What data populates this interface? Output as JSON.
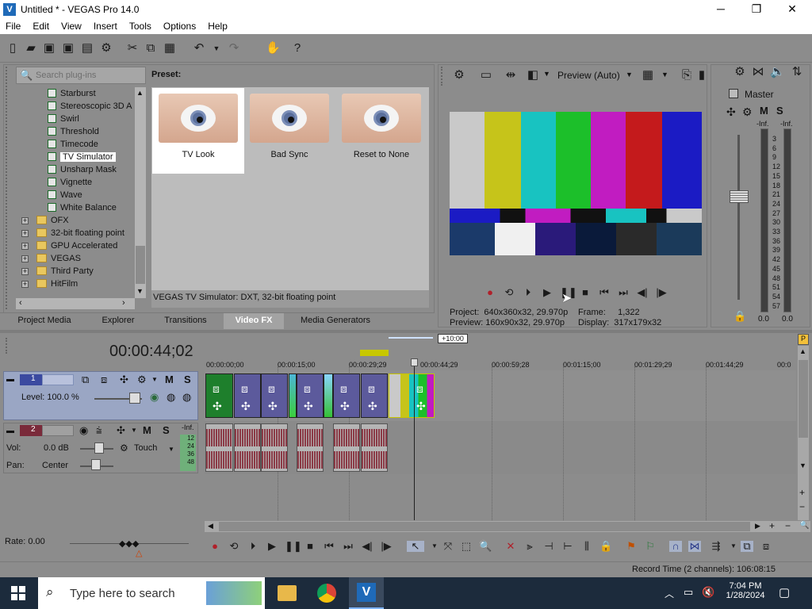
{
  "window": {
    "title": "Untitled * - VEGAS Pro 14.0",
    "min": "─",
    "max": "❐",
    "close": "✕"
  },
  "menu": [
    "File",
    "Edit",
    "View",
    "Insert",
    "Tools",
    "Options",
    "Help"
  ],
  "fx_panel": {
    "search_placeholder": "Search plug-ins",
    "preset_label": "Preset:",
    "tree_items": [
      {
        "label": "Starburst",
        "type": "fx"
      },
      {
        "label": "Stereoscopic 3D A",
        "type": "fx"
      },
      {
        "label": "Swirl",
        "type": "fx"
      },
      {
        "label": "Threshold",
        "type": "fx"
      },
      {
        "label": "Timecode",
        "type": "fx"
      },
      {
        "label": "TV Simulator",
        "type": "fx",
        "selected": true
      },
      {
        "label": "Unsharp Mask",
        "type": "fx"
      },
      {
        "label": "Vignette",
        "type": "fx"
      },
      {
        "label": "Wave",
        "type": "fx"
      },
      {
        "label": "White Balance",
        "type": "fx"
      },
      {
        "label": "OFX",
        "type": "folder"
      },
      {
        "label": "32-bit floating point",
        "type": "folder"
      },
      {
        "label": "GPU Accelerated",
        "type": "folder"
      },
      {
        "label": "VEGAS",
        "type": "folder"
      },
      {
        "label": "Third Party",
        "type": "folder"
      },
      {
        "label": "HitFilm",
        "type": "folder"
      }
    ],
    "presets": [
      "TV Look",
      "Bad Sync",
      "Reset to None"
    ],
    "status": "VEGAS TV Simulator: DXT, 32-bit floating point"
  },
  "tabs": [
    "Project Media",
    "Explorer",
    "Transitions",
    "Video FX",
    "Media Generators"
  ],
  "active_tab": "Video FX",
  "preview": {
    "mode": "Preview (Auto)",
    "project_label": "Project:",
    "project_value": "640x360x32, 29.970p",
    "preview_label": "Preview:",
    "preview_value": "160x90x32, 29.970p",
    "frame_label": "Frame:",
    "frame_value": "1,322",
    "display_label": "Display:",
    "display_value": "317x179x32",
    "bar_colors": [
      "#c9c9c9",
      "#c6c41a",
      "#18c3c1",
      "#1cbf2a",
      "#c11cc1",
      "#c41a1c",
      "#1b1bc4"
    ]
  },
  "master": {
    "label": "Master",
    "m": "M",
    "s": "S",
    "inf_left": "-Inf.",
    "inf_right": "-Inf.",
    "scale": [
      "3",
      "6",
      "9",
      "12",
      "15",
      "18",
      "21",
      "24",
      "27",
      "30",
      "33",
      "36",
      "39",
      "42",
      "45",
      "48",
      "51",
      "54",
      "57"
    ],
    "bottom_left": "0.0",
    "bottom_right": "0.0"
  },
  "timeline": {
    "timecode": "00:00:44;02",
    "offset": "+10:00",
    "ruler": [
      "00:00:00;00",
      "00:00:15;00",
      "00:00:29;29",
      "00:00:44;29",
      "00:00:59;28",
      "00:01:15;00",
      "00:01:29;29",
      "00:01:44;29",
      "00:0"
    ],
    "track1": {
      "num": "1",
      "level": "Level: 100.0 %",
      "m": "M",
      "s": "S"
    },
    "track2": {
      "num": "2",
      "vol_label": "Vol:",
      "vol_value": "0.0 dB",
      "pan_label": "Pan:",
      "pan_value": "Center",
      "touch": "Touch",
      "m": "M",
      "s": "S",
      "inf": "-Inf.",
      "meter": [
        "12",
        "24",
        "36",
        "48"
      ]
    },
    "rate": "Rate: 0.00",
    "record_time": "Record Time (2 channels): 106:08:15"
  },
  "taskbar": {
    "search": "Type here to search",
    "time": "7:04 PM",
    "date": "1/28/2024"
  }
}
